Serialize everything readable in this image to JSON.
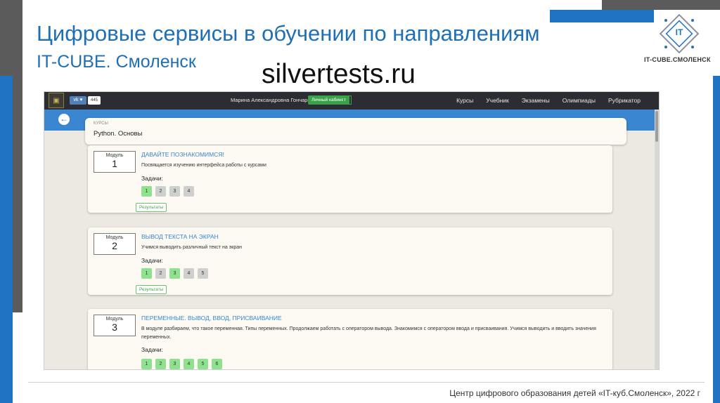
{
  "slide": {
    "title": "Цифровые сервисы в обучении по направлениям",
    "subtitle": "IT-CUBE. Смоленск",
    "watermark": "silvertests.ru",
    "logo_text": "IT-CUBE.СМОЛЕНСК",
    "footer": "Центр цифрового образования детей «IT-куб.Смоленск», 2022 г"
  },
  "app": {
    "topbar": {
      "counter": "445",
      "user_name": "Марина Александровна Гончарова",
      "cabinet_label": "Личный кабинет",
      "nav": [
        "Курсы",
        "Учебник",
        "Экзамены",
        "Олимпиады",
        "Рубрикатор"
      ]
    },
    "course": {
      "crumb": "КУРСЫ",
      "title": "Python. Основы"
    },
    "tasks_label": "Задачи:",
    "module_label": "Модуль",
    "results_label": "Результаты",
    "modules": [
      {
        "number": "1",
        "title": "ДАВАЙТЕ ПОЗНАКОМИМСЯ!",
        "description": "Посвящается изучению интерфейса работы с курсами",
        "tasks": [
          {
            "n": "1",
            "done": true
          },
          {
            "n": "2",
            "done": false
          },
          {
            "n": "3",
            "done": false
          },
          {
            "n": "4",
            "done": false
          }
        ]
      },
      {
        "number": "2",
        "title": "ВЫВОД ТЕКСТА НА ЭКРАН",
        "description": "Учимся выводить различный текст на экран",
        "tasks": [
          {
            "n": "1",
            "done": true
          },
          {
            "n": "2",
            "done": false
          },
          {
            "n": "3",
            "done": true
          },
          {
            "n": "4",
            "done": false
          },
          {
            "n": "5",
            "done": false
          }
        ]
      },
      {
        "number": "3",
        "title": "ПЕРЕМЕННЫЕ. ВЫВОД, ВВОД, ПРИСВАИВАНИЕ",
        "description": "В модуле разбираем, что такое переменная. Типы переменных. Продолжаем работать с оператором вывода. Знакомимся с оператором ввода и присваивания. Учимся выводить и вводить значения переменных.",
        "tasks": [
          {
            "n": "1",
            "done": true
          },
          {
            "n": "2",
            "done": true
          },
          {
            "n": "3",
            "done": true
          },
          {
            "n": "4",
            "done": true
          },
          {
            "n": "5",
            "done": true
          },
          {
            "n": "6",
            "done": true
          }
        ]
      }
    ]
  },
  "colors": {
    "accent_blue": "#1f6fb5",
    "deco_gray": "#5b5b5b",
    "app_header": "#2c2d33",
    "app_blue": "#3a86d0",
    "task_done": "#8ee28e",
    "task_todo": "#cfcfcf"
  }
}
